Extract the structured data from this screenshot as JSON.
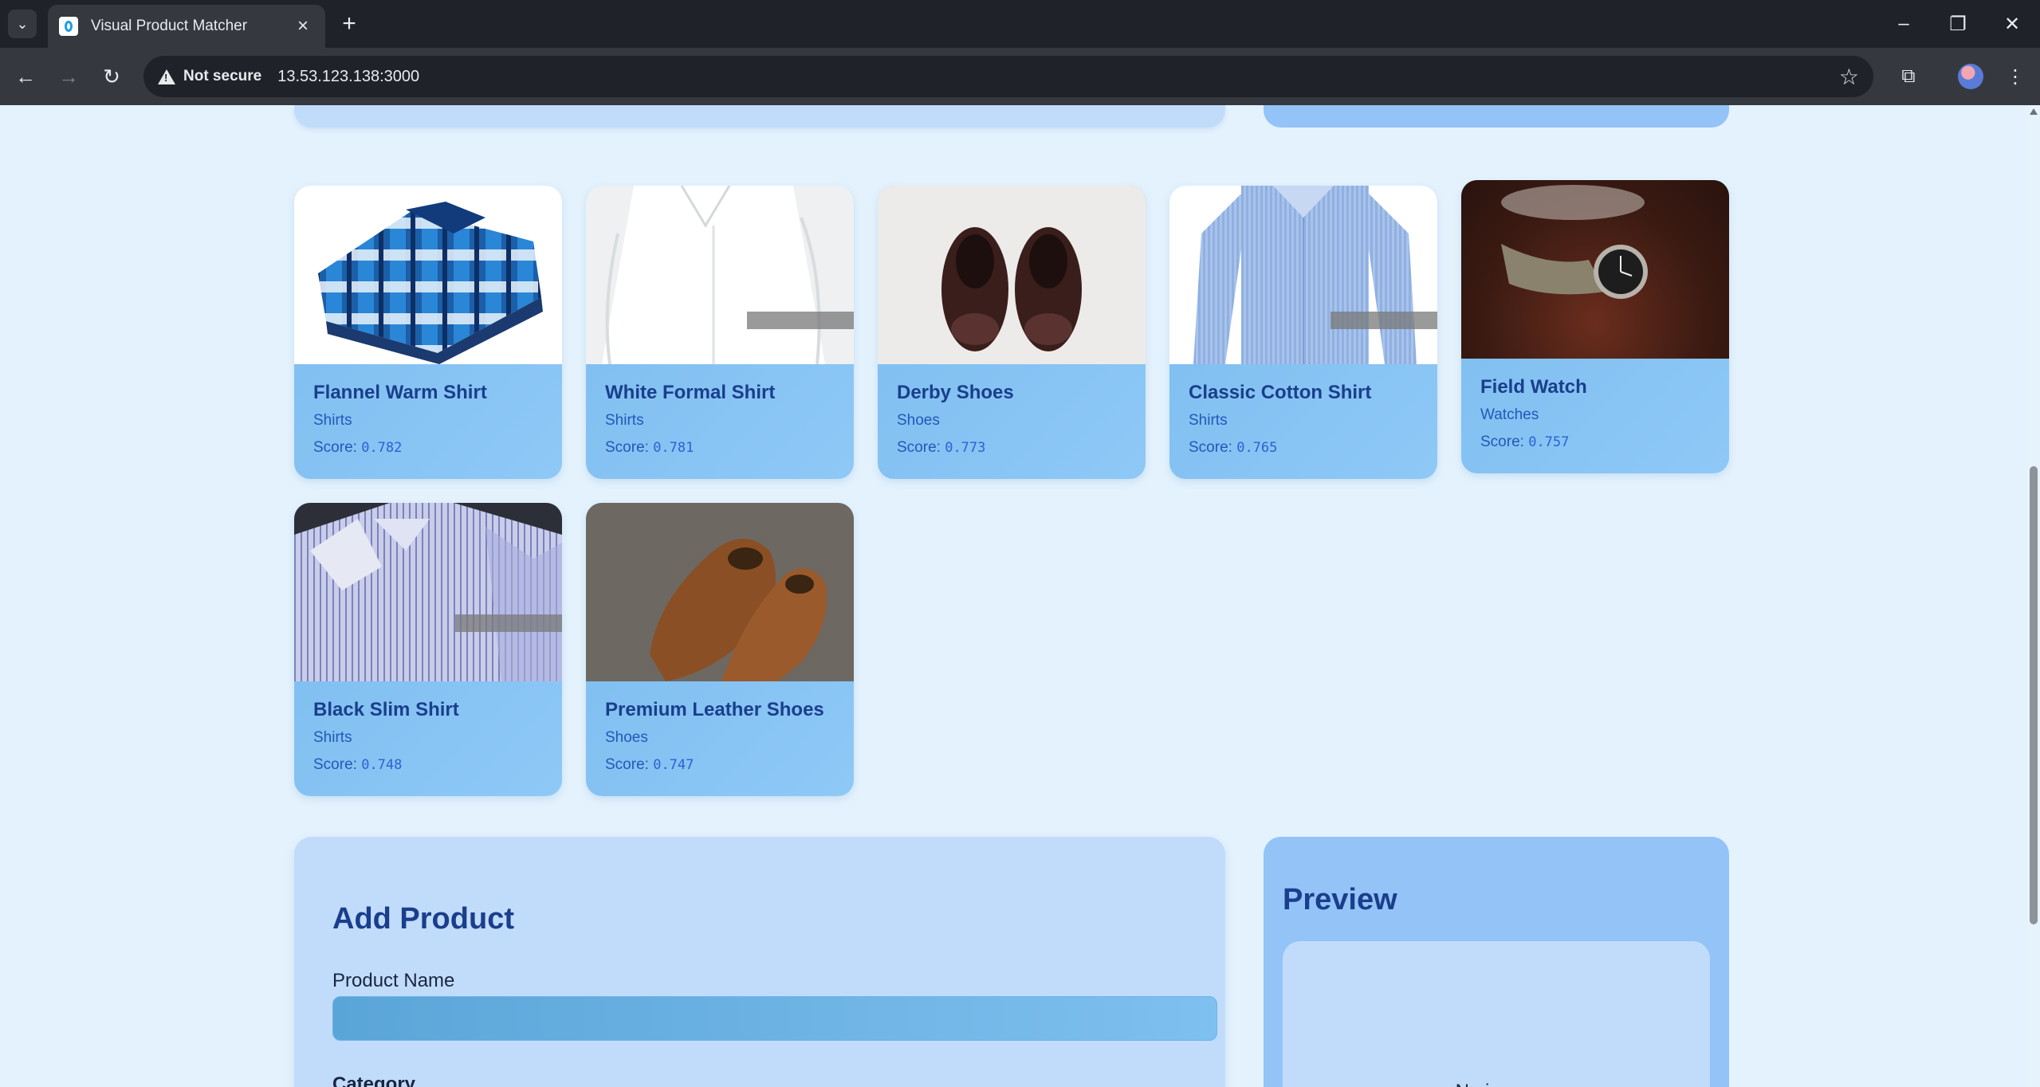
{
  "browser": {
    "tab_title": "Visual Product Matcher",
    "security_label": "Not secure",
    "url": "13.53.123.138:3000"
  },
  "results": [
    {
      "name": "Flannel Warm Shirt",
      "category": "Shirts",
      "score_label": "Score:",
      "score": "0.782"
    },
    {
      "name": "White Formal Shirt",
      "category": "Shirts",
      "score_label": "Score:",
      "score": "0.781"
    },
    {
      "name": "Derby Shoes",
      "category": "Shoes",
      "score_label": "Score:",
      "score": "0.773"
    },
    {
      "name": "Classic Cotton Shirt",
      "category": "Shirts",
      "score_label": "Score:",
      "score": "0.765"
    },
    {
      "name": "Field Watch",
      "category": "Watches",
      "score_label": "Score:",
      "score": "0.757"
    },
    {
      "name": "Black Slim Shirt",
      "category": "Shirts",
      "score_label": "Score:",
      "score": "0.748"
    },
    {
      "name": "Premium Leather Shoes",
      "category": "Shoes",
      "score_label": "Score:",
      "score": "0.747"
    }
  ],
  "add_product": {
    "title": "Add Product",
    "name_label": "Product Name",
    "name_value": "",
    "category_label": "Category"
  },
  "preview": {
    "title": "Preview",
    "placeholder": "No image"
  },
  "colors": {
    "page_bg": "#e4f2fd",
    "card_bg": "#8ec8f7",
    "title_text": "#1a3e8c",
    "panel_light": "#c1dcfb",
    "panel_mid": "#93c3f7"
  }
}
